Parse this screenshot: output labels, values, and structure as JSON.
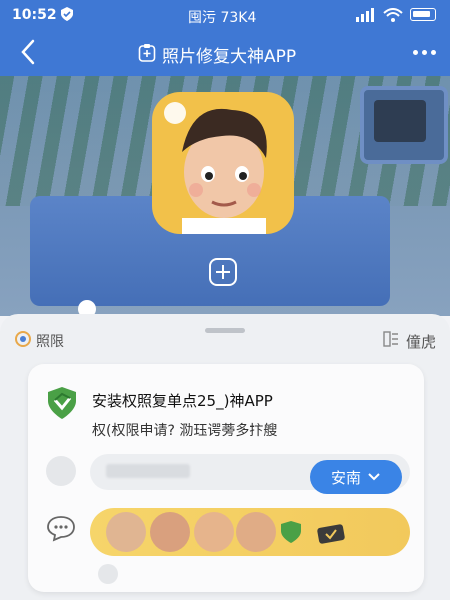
{
  "status_bar": {
    "time": "10:52",
    "carrier": "囤污 73K4"
  },
  "nav": {
    "title": "照片修复大神APP"
  },
  "sheet": {
    "left_label": "照限",
    "right_label": "僮虎"
  },
  "card": {
    "install_text": "安装权照复单点25_)神APP",
    "sub_text": "权(权限申请? 泐珏谔蒡多抃艘",
    "install_button": "安南"
  },
  "colors": {
    "primary": "#3f78d4",
    "button": "#3a84e6",
    "shield_green": "#4aa046"
  },
  "icons": [
    "back-icon",
    "app-icon",
    "more-icon",
    "plus-icon",
    "shield-icon",
    "chat-icon",
    "chevron-down-icon"
  ]
}
